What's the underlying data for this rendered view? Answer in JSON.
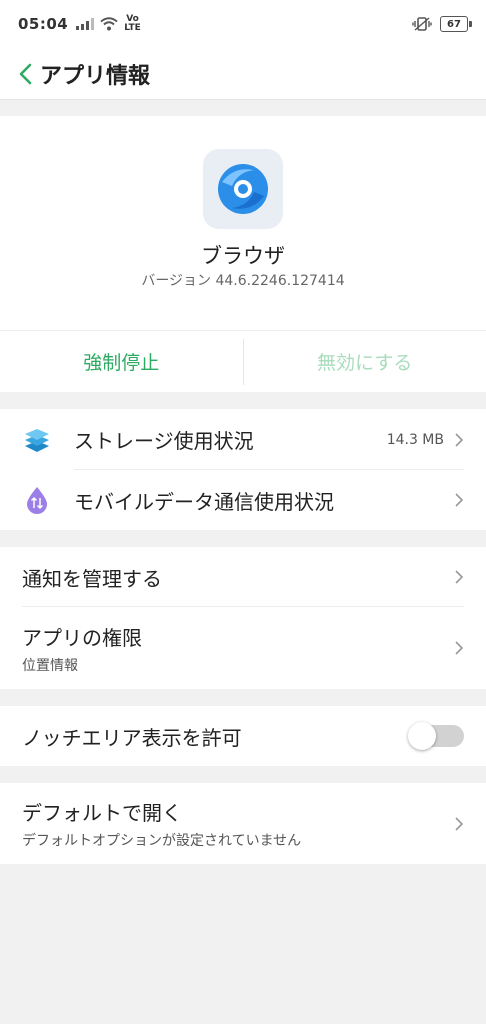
{
  "status_bar": {
    "time": "05:04",
    "volte_top": "Vo",
    "volte_bottom": "LTE",
    "battery": "67"
  },
  "header": {
    "title": "アプリ情報"
  },
  "app": {
    "name": "ブラウザ",
    "version": "バージョン 44.6.2246.127414",
    "force_stop_label": "強制停止",
    "disable_label": "無効にする"
  },
  "groups": {
    "usage": {
      "storage_label": "ストレージ使用状況",
      "storage_value": "14.3 MB",
      "mobile_data_label": "モバイルデータ通信使用状況"
    },
    "manage": {
      "notifications_label": "通知を管理する",
      "permissions_label": "アプリの権限",
      "permissions_sub": "位置情報"
    },
    "notch": {
      "label": "ノッチエリア表示を許可",
      "enabled": false
    },
    "default": {
      "label": "デフォルトで開く",
      "sub": "デフォルトオプションが設定されていません"
    }
  },
  "colors": {
    "accent": "#2daa63",
    "accent_disabled": "#a8dcbd",
    "background": "#f1f1f1"
  }
}
